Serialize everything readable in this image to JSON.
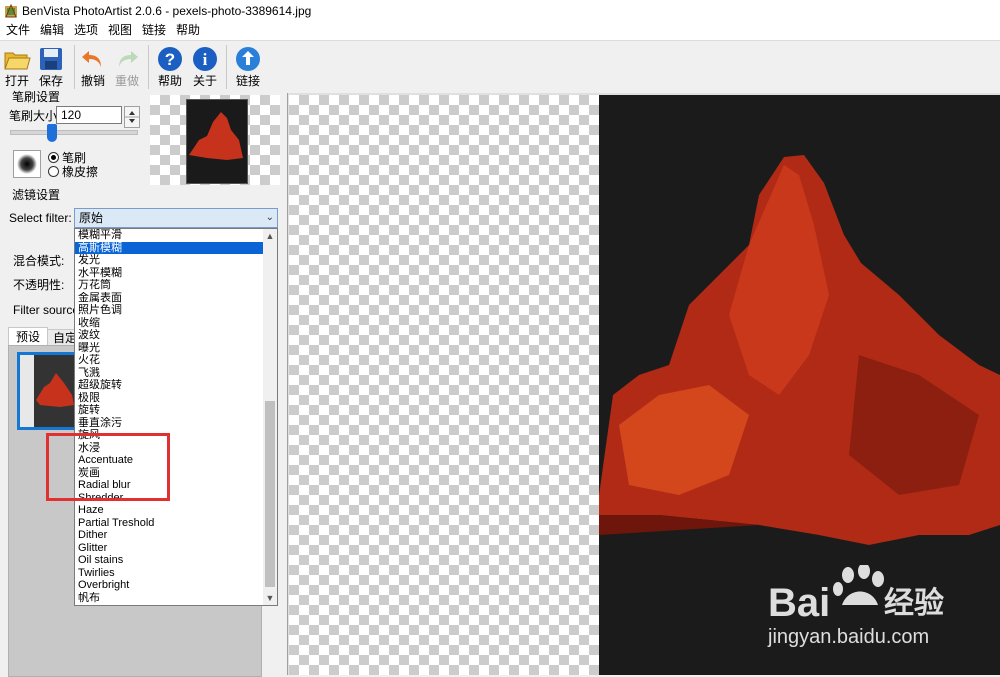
{
  "window": {
    "title": "BenVista PhotoArtist 2.0.6 - pexels-photo-3389614.jpg"
  },
  "menu": [
    "文件",
    "编辑",
    "选项",
    "视图",
    "链接",
    "帮助"
  ],
  "toolbar": {
    "open": "打开",
    "save": "保存",
    "undo": "撤销",
    "redo": "重做",
    "help": "帮助",
    "about": "关于",
    "link": "链接"
  },
  "brush_settings": {
    "heading": "笔刷设置",
    "size_label": "笔刷大小:",
    "size_value": "120",
    "mode_brush": "笔刷",
    "mode_eraser": "橡皮擦"
  },
  "filter_settings": {
    "heading": "滤镜设置",
    "select_label": "Select filter:",
    "selected_value": "原始",
    "blend_label": "混合模式:",
    "opacity_label": "不透明性:",
    "source_label": "Filter source:"
  },
  "tabs": {
    "preset": "预设",
    "custom": "自定"
  },
  "dropdown_items": [
    "模糊平滑",
    "高斯模糊",
    "发光",
    "水平模糊",
    "万花筒",
    "金属表面",
    "照片色调",
    "收缩",
    "波纹",
    "曝光",
    "火花",
    "飞溅",
    "超级旋转",
    "极限",
    "旋转",
    "垂直涂污",
    "旋风",
    "水浸",
    "Accentuate",
    "炭画",
    "Radial blur",
    "Shredder",
    "Haze",
    "Partial Treshold",
    "Dither",
    "Glitter",
    "Oil stains",
    "Twirlies",
    "Overbright",
    "帆布"
  ],
  "dropdown_selected_index": 1,
  "watermark": {
    "brand": "Bai",
    "brand_cn": "经验",
    "url": "jingyan.baidu.com"
  },
  "colors": {
    "accent": "#0a64d6",
    "highlight_box": "#e03030"
  }
}
